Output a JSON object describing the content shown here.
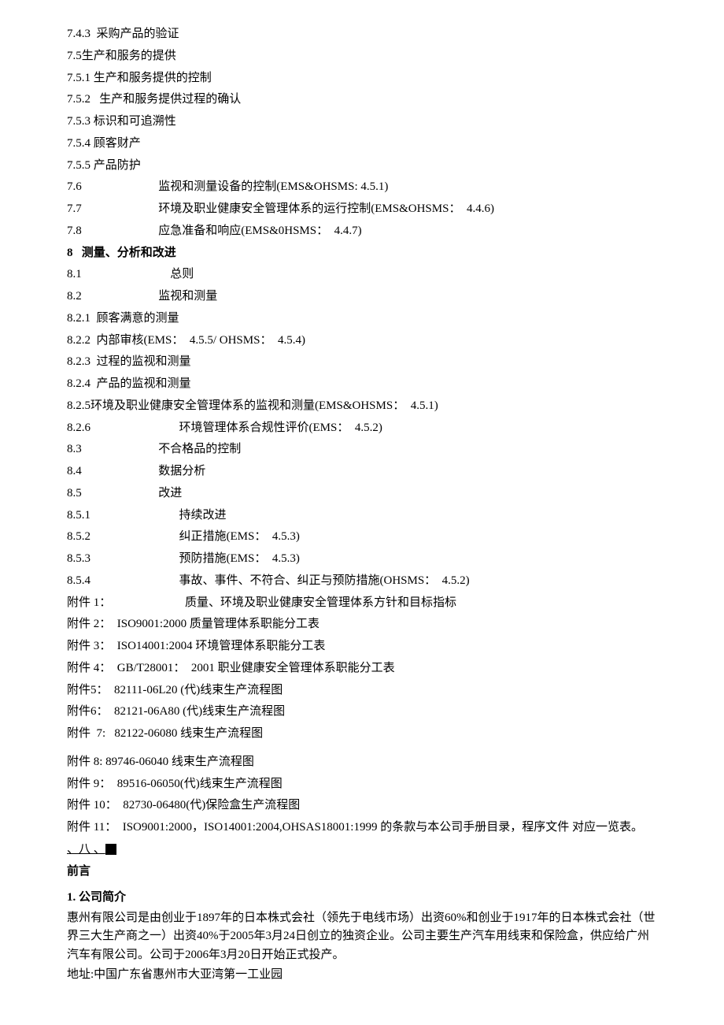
{
  "lines": [
    {
      "text": "7.4.3  采购产品的验证"
    },
    {
      "text": "7.5生产和服务的提供"
    },
    {
      "text": "7.5.1 生产和服务提供的控制"
    },
    {
      "text": "7.5.2   生产和服务提供过程的确认"
    },
    {
      "text": "7.5.3 标识和可追溯性"
    },
    {
      "text": "7.5.4 顾客财产"
    },
    {
      "text": "7.5.5 产品防护"
    },
    {
      "text": "7.6                          监视和测量设备的控制(EMS&OHSMS: 4.5.1)"
    },
    {
      "text": "7.7                          环境及职业健康安全管理体系的运行控制(EMS&OHSMS：  4.4.6)"
    },
    {
      "text": "7.8                          应急准备和响应(EMS&0HSMS：  4.4.7)"
    },
    {
      "text": "8   测量、分析和改进",
      "bold": true
    },
    {
      "text": "8.1                              总则"
    },
    {
      "text": "8.2                          监视和测量"
    },
    {
      "text": "8.2.1  顾客满意的测量"
    },
    {
      "text": "8.2.2  内部审核(EMS：  4.5.5/ OHSMS：  4.5.4)"
    },
    {
      "text": "8.2.3  过程的监视和测量"
    },
    {
      "text": "8.2.4  产品的监视和测量"
    },
    {
      "text": "8.2.5环境及职业健康安全管理体系的监视和测量(EMS&OHSMS：  4.5.1)"
    },
    {
      "text": "8.2.6                              环境管理体系合规性评价(EMS：  4.5.2)"
    },
    {
      "text": "8.3                          不合格品的控制"
    },
    {
      "text": "8.4                          数据分析"
    },
    {
      "text": "8.5                          改进"
    },
    {
      "text": "8.5.1                              持续改进"
    },
    {
      "text": "8.5.2                              纠正措施(EMS：  4.5.3)"
    },
    {
      "text": "8.5.3                              预防措施(EMS：  4.5.3)"
    },
    {
      "text": "8.5.4                              事故、事件、不符合、纠正与预防措施(OHSMS：  4.5.2)"
    },
    {
      "text": "附件 1：                         质量、环境及职业健康安全管理体系方针和目标指标"
    },
    {
      "text": "附件 2：  ISO9001:2000 质量管理体系职能分工表"
    },
    {
      "text": "附件 3：  ISO14001:2004 环境管理体系职能分工表"
    },
    {
      "text": "附件 4：  GB/T28001：  2001 职业健康安全管理体系职能分工表"
    },
    {
      "text": "附件5：  82111-06L20 (代)线束生产流程图"
    },
    {
      "text": "附件6：  82121-06A80 (代)线束生产流程图"
    },
    {
      "text": "附件  7:   82122-06080 线束生产流程图"
    },
    {
      "text": "附件 8: 89746-06040 线束生产流程图",
      "spaced": true
    },
    {
      "text": "附件 9：  89516-06050(代)线束生产流程图"
    },
    {
      "text": "附件 10：  82730-06480(代)保险盒生产流程图"
    },
    {
      "text": "附件 11：  ISO9001:2000，ISO14001:2004,OHSAS18001:1999 的条款与本公司手册目录，程序文件 对应一览表。"
    }
  ],
  "marker_line": {
    "prefix": "、八 、"
  },
  "preface": "前言",
  "intro_header": "1. 公司简介",
  "intro_body": "惠州有限公司是由创业于1897年的日本株式会社（领先于电线市场）出资60%和创业于1917年的日本株式会社（世界三大生产商之一）出资40%于2005年3月24日创立的独资企业。公司主要生产汽车用线束和保险盒，供应给广州汽车有限公司。公司于2006年3月20日开始正式投产。",
  "address": "地址:中国广东省惠州市大亚湾第一工业园"
}
